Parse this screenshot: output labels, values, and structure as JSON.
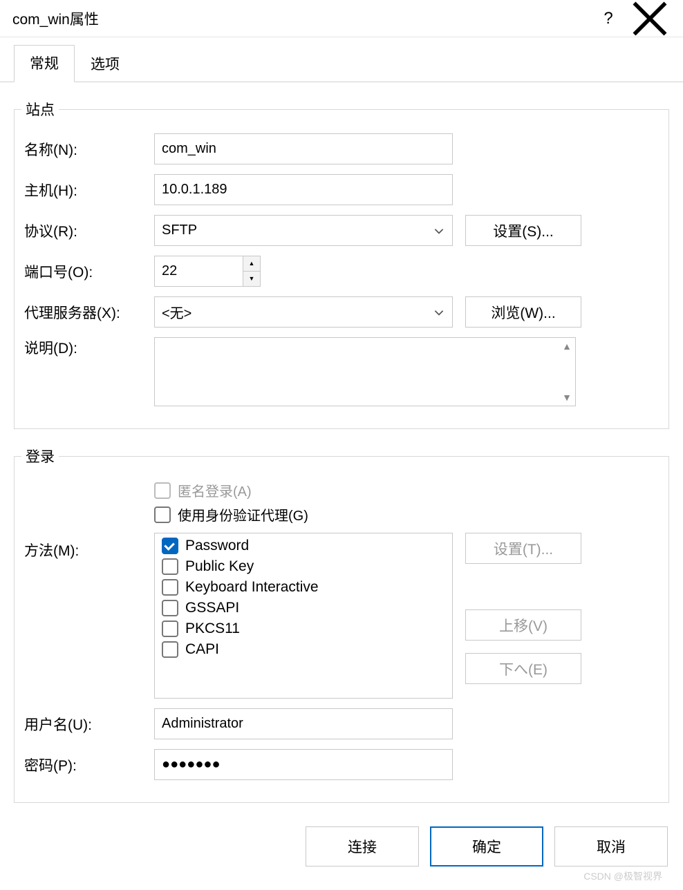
{
  "title": "com_win属性",
  "tabs": {
    "general": "常规",
    "options": "选项"
  },
  "site": {
    "legend": "站点",
    "name_label": "名称(N):",
    "name_value": "com_win",
    "host_label": "主机(H):",
    "host_value": "10.0.1.189",
    "protocol_label": "协议(R):",
    "protocol_value": "SFTP",
    "settings_btn": "设置(S)...",
    "port_label": "端口号(O):",
    "port_value": "22",
    "proxy_label": "代理服务器(X):",
    "proxy_value": "<无>",
    "browse_btn": "浏览(W)...",
    "desc_label": "说明(D):",
    "desc_value": ""
  },
  "login": {
    "legend": "登录",
    "anonymous": "匿名登录(A)",
    "auth_agent": "使用身份验证代理(G)",
    "method_label": "方法(M):",
    "methods": {
      "password": "Password",
      "publickey": "Public Key",
      "keyboard": "Keyboard Interactive",
      "gssapi": "GSSAPI",
      "pkcs11": "PKCS11",
      "capi": "CAPI"
    },
    "settings_btn": "设置(T)...",
    "moveup_btn": "上移(V)",
    "movedown_btn": "下へ(E)",
    "user_label": "用户名(U):",
    "user_value": "Administrator",
    "pass_label": "密码(P):",
    "pass_value": "●●●●●●●"
  },
  "footer": {
    "connect": "连接",
    "ok": "确定",
    "cancel": "取消"
  },
  "watermark": "CSDN @极智视界"
}
